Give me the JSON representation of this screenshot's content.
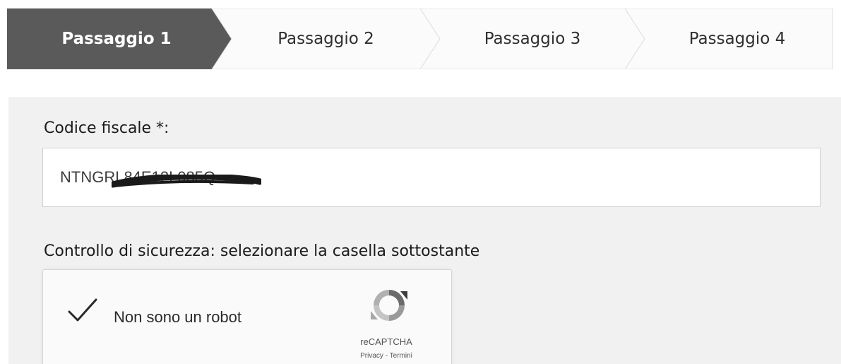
{
  "stepper": {
    "steps": [
      {
        "label": "Passaggio 1",
        "active": true
      },
      {
        "label": "Passaggio 2",
        "active": false
      },
      {
        "label": "Passaggio 3",
        "active": false
      },
      {
        "label": "Passaggio 4",
        "active": false
      }
    ],
    "active_color": "#5a5a5a",
    "inactive_color": "#fbfbfb"
  },
  "form": {
    "codice_fiscale": {
      "label": "Codice fiscale *:",
      "value": "NTNGRL84E12L085Q"
    },
    "security": {
      "label": "Controllo di sicurezza: selezionare la casella sottostante"
    }
  },
  "captcha": {
    "checked": true,
    "check_icon": "checkmark-icon",
    "label": "Non sono un robot",
    "brand": "reCAPTCHA",
    "privacy_link": "Privacy",
    "separator": " - ",
    "terms_link": "Termini",
    "logo_icon": "recaptcha-logo-icon"
  },
  "colors": {
    "panel_bg": "#f1f1f1",
    "check_green": "#2a2a2a"
  }
}
